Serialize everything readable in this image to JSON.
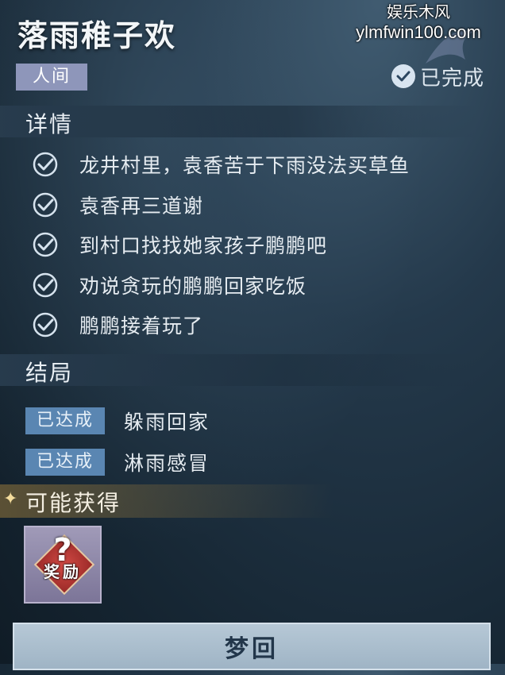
{
  "quest": {
    "title": "落雨稚子欢",
    "category": "人间",
    "status": "已完成"
  },
  "watermark": {
    "line1": "娱乐木风",
    "line2": "ylmfwin100.com"
  },
  "details": {
    "header": "详情",
    "objectives": [
      "龙井村里，袁香苦于下雨没法买草鱼",
      "袁香再三道谢",
      "到村口找找她家孩子鹏鹏吧",
      "劝说贪玩的鹏鹏回家吃饭",
      "鹏鹏接着玩了"
    ]
  },
  "endings": {
    "header": "结局",
    "items": [
      {
        "badge": "已达成",
        "text": "躲雨回家"
      },
      {
        "badge": "已达成",
        "text": "淋雨感冒"
      }
    ]
  },
  "rewards": {
    "header": "可能获得",
    "slot_mark": "?",
    "slot_text": "奖励"
  },
  "action": {
    "button_label": "梦回"
  },
  "colors": {
    "tag": "#8e96ba",
    "badge": "#5a86b2",
    "button": "#9fb4c5"
  }
}
